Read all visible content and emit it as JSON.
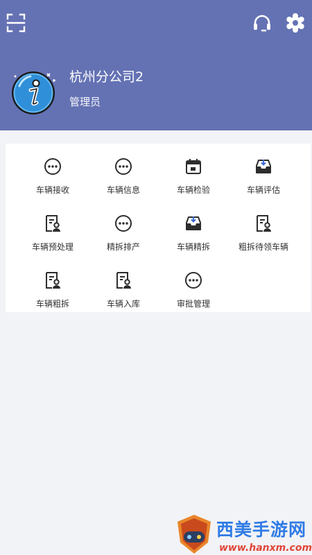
{
  "header": {
    "company": "杭州分公司2",
    "role": "管理员",
    "background_color": "#6472b4",
    "icons": [
      "scan-icon",
      "headset-icon",
      "settings-gear-icon"
    ]
  },
  "menu": {
    "items": [
      {
        "label": "车辆接收",
        "icon": "more-circle"
      },
      {
        "label": "车辆信息",
        "icon": "more-circle"
      },
      {
        "label": "车辆检验",
        "icon": "calendar"
      },
      {
        "label": "车辆评估",
        "icon": "inbox-download"
      },
      {
        "label": "车辆预处理",
        "icon": "document-user"
      },
      {
        "label": "精拆排产",
        "icon": "more-circle"
      },
      {
        "label": "车辆精拆",
        "icon": "inbox-download"
      },
      {
        "label": "粗拆待领车辆",
        "icon": "document-user"
      },
      {
        "label": "车辆粗拆",
        "icon": "document-user"
      },
      {
        "label": "车辆入库",
        "icon": "document-user"
      },
      {
        "label": "审批管理",
        "icon": "more-circle"
      }
    ]
  },
  "watermark": {
    "title": "西美手游网",
    "url": "www.hanxm.com"
  }
}
